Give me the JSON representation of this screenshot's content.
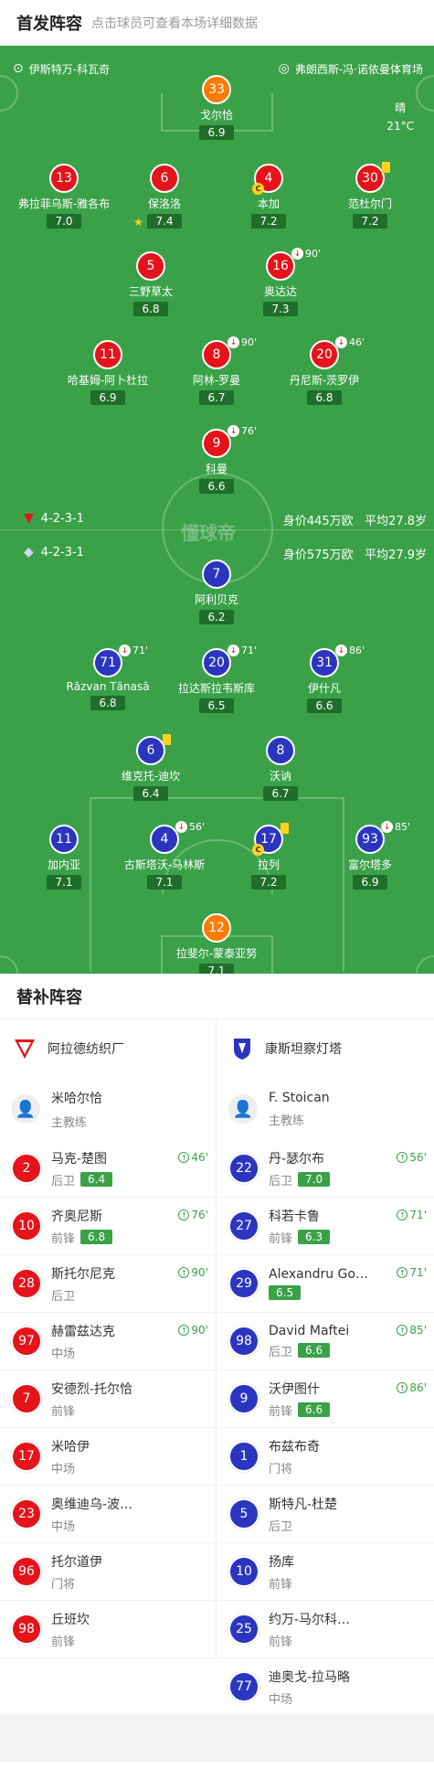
{
  "header": {
    "title": "首发阵容",
    "subtitle": "点击球员可查看本场详细数据"
  },
  "venue": {
    "left": "伊斯特万-科瓦奇",
    "right": "弗朗西斯-冯·诺依曼体育场"
  },
  "weather": {
    "label": "晴",
    "temp": "21°C"
  },
  "watermark": "懂球帝",
  "home_team": {
    "formation": "4-2-3-1",
    "value": "身价445万欧",
    "age": "平均27.8岁"
  },
  "away_team": {
    "formation": "4-2-3-1",
    "value": "身价575万欧",
    "age": "平均27.9岁"
  },
  "home": [
    {
      "n": "33",
      "name": "戈尔恰",
      "rating": "6.9",
      "color": "orange"
    },
    {
      "n": "13",
      "name": "弗拉菲乌斯-雅各布",
      "rating": "7.0",
      "color": "red"
    },
    {
      "n": "6",
      "name": "保洛洛",
      "rating": "7.4",
      "color": "red",
      "star": true
    },
    {
      "n": "4",
      "name": "本加",
      "rating": "7.2",
      "color": "red",
      "cap": true
    },
    {
      "n": "30",
      "name": "范杜尔门",
      "rating": "7.2",
      "color": "red",
      "yellow": true
    },
    {
      "n": "5",
      "name": "三野草太",
      "rating": "6.8",
      "color": "red"
    },
    {
      "n": "16",
      "name": "奥达达",
      "rating": "7.3",
      "color": "red",
      "sub": "90'"
    },
    {
      "n": "11",
      "name": "哈基姆-阿卜杜拉",
      "rating": "6.9",
      "color": "red"
    },
    {
      "n": "8",
      "name": "阿林-罗曼",
      "rating": "6.7",
      "color": "red",
      "sub": "90'"
    },
    {
      "n": "20",
      "name": "丹尼斯-茨罗伊",
      "rating": "6.8",
      "color": "red",
      "sub": "46'"
    },
    {
      "n": "9",
      "name": "科曼",
      "rating": "6.6",
      "color": "red",
      "sub": "76'"
    }
  ],
  "away": [
    {
      "n": "7",
      "name": "阿利贝克",
      "rating": "6.2",
      "color": "blue"
    },
    {
      "n": "71",
      "name": "Răzvan Tănasă",
      "rating": "6.8",
      "color": "blue",
      "sub": "71'"
    },
    {
      "n": "20",
      "name": "拉达斯拉韦斯库",
      "rating": "6.5",
      "color": "blue",
      "sub": "71'"
    },
    {
      "n": "31",
      "name": "伊什凡",
      "rating": "6.6",
      "color": "blue",
      "sub": "86'"
    },
    {
      "n": "6",
      "name": "维克托-迪坎",
      "rating": "6.4",
      "color": "blue",
      "yellow": true
    },
    {
      "n": "8",
      "name": "沃讷",
      "rating": "6.7",
      "color": "blue"
    },
    {
      "n": "11",
      "name": "加内亚",
      "rating": "7.1",
      "color": "blue"
    },
    {
      "n": "4",
      "name": "古斯塔沃-马林斯",
      "rating": "7.1",
      "color": "blue",
      "sub": "56'"
    },
    {
      "n": "17",
      "name": "拉列",
      "rating": "7.2",
      "color": "blue",
      "cap": true,
      "yellow": true
    },
    {
      "n": "93",
      "name": "富尔塔多",
      "rating": "6.9",
      "color": "blue",
      "sub": "85'"
    },
    {
      "n": "12",
      "name": "拉斐尔-蒙泰亚努",
      "rating": "7.1",
      "color": "orange"
    }
  ],
  "subs": {
    "title": "替补阵容",
    "left": {
      "team": "阿拉德纺织厂",
      "coach": {
        "name": "米哈尔恰",
        "role": "主教练"
      },
      "players": [
        {
          "n": "2",
          "name": "马克-楚图",
          "pos": "后卫",
          "rating": "6.4",
          "in": "46'"
        },
        {
          "n": "10",
          "name": "齐奥尼斯",
          "pos": "前锋",
          "rating": "6.8",
          "in": "76'"
        },
        {
          "n": "28",
          "name": "斯托尔尼克",
          "pos": "后卫",
          "in": "90'"
        },
        {
          "n": "97",
          "name": "赫雷兹达克",
          "pos": "中场",
          "in": "90'"
        },
        {
          "n": "7",
          "name": "安德烈-托尔恰",
          "pos": "前锋"
        },
        {
          "n": "17",
          "name": "米哈伊",
          "pos": "中场"
        },
        {
          "n": "23",
          "name": "奥维迪乌-波…",
          "pos": "中场"
        },
        {
          "n": "96",
          "name": "托尔道伊",
          "pos": "门将"
        },
        {
          "n": "98",
          "name": "丘班坎",
          "pos": "前锋"
        }
      ]
    },
    "right": {
      "team": "康斯坦察灯塔",
      "coach": {
        "name": "F. Stoican",
        "role": "主教练"
      },
      "players": [
        {
          "n": "22",
          "name": "丹-瑟尔布",
          "pos": "后卫",
          "rating": "7.0",
          "in": "56'"
        },
        {
          "n": "27",
          "name": "科若卡鲁",
          "pos": "前锋",
          "rating": "6.3",
          "in": "71'"
        },
        {
          "n": "29",
          "name": "Alexandru Go…",
          "pos": "",
          "rating": "6.5",
          "in": "71'"
        },
        {
          "n": "98",
          "name": "David Maftei",
          "pos": "后卫",
          "rating": "6.6",
          "in": "85'"
        },
        {
          "n": "9",
          "name": "沃伊图什",
          "pos": "前锋",
          "rating": "6.6",
          "in": "86'"
        },
        {
          "n": "1",
          "name": "布兹布奇",
          "pos": "门将"
        },
        {
          "n": "5",
          "name": "斯特凡-杜楚",
          "pos": "后卫"
        },
        {
          "n": "10",
          "name": "扬库",
          "pos": "前锋"
        },
        {
          "n": "25",
          "name": "约万-马尔科…",
          "pos": "前锋"
        },
        {
          "n": "77",
          "name": "迪奥戈-拉马略",
          "pos": "中场"
        }
      ]
    }
  },
  "colors": {
    "pitch": "#3aa149",
    "home": "#e5131a",
    "away": "#2b35c0",
    "gk": "#ff7a00",
    "rating_bg": "#1f6e2a"
  }
}
